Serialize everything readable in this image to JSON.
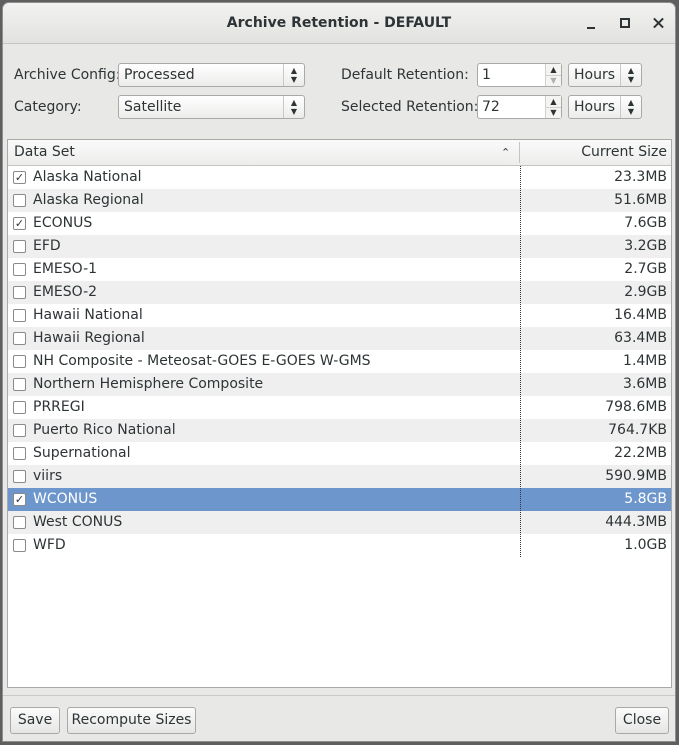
{
  "window": {
    "title": "Archive Retention - DEFAULT"
  },
  "form": {
    "archive_config_label": "Archive Config:",
    "archive_config_value": "Processed",
    "category_label": "Category:",
    "category_value": "Satellite",
    "default_retention_label": "Default Retention:",
    "default_retention_value": "1",
    "default_retention_unit": "Hours",
    "selected_retention_label": "Selected Retention:",
    "selected_retention_value": "72",
    "selected_retention_unit": "Hours"
  },
  "table": {
    "columns": [
      "Data Set",
      "Current Size"
    ],
    "rows": [
      {
        "name": "Alaska National",
        "size": "23.3MB",
        "checked": true,
        "selected": false
      },
      {
        "name": "Alaska Regional",
        "size": "51.6MB",
        "checked": false,
        "selected": false
      },
      {
        "name": "ECONUS",
        "size": "7.6GB",
        "checked": true,
        "selected": false
      },
      {
        "name": "EFD",
        "size": "3.2GB",
        "checked": false,
        "selected": false
      },
      {
        "name": "EMESO-1",
        "size": "2.7GB",
        "checked": false,
        "selected": false
      },
      {
        "name": "EMESO-2",
        "size": "2.9GB",
        "checked": false,
        "selected": false
      },
      {
        "name": "Hawaii National",
        "size": "16.4MB",
        "checked": false,
        "selected": false
      },
      {
        "name": "Hawaii Regional",
        "size": "63.4MB",
        "checked": false,
        "selected": false
      },
      {
        "name": "NH Composite - Meteosat-GOES E-GOES W-GMS",
        "size": "1.4MB",
        "checked": false,
        "selected": false
      },
      {
        "name": "Northern Hemisphere Composite",
        "size": "3.6MB",
        "checked": false,
        "selected": false
      },
      {
        "name": "PRREGI",
        "size": "798.6MB",
        "checked": false,
        "selected": false
      },
      {
        "name": "Puerto Rico National",
        "size": "764.7KB",
        "checked": false,
        "selected": false
      },
      {
        "name": "Supernational",
        "size": "22.2MB",
        "checked": false,
        "selected": false
      },
      {
        "name": "viirs",
        "size": "590.9MB",
        "checked": false,
        "selected": false
      },
      {
        "name": "WCONUS",
        "size": "5.8GB",
        "checked": true,
        "selected": true
      },
      {
        "name": "West CONUS",
        "size": "444.3MB",
        "checked": false,
        "selected": false
      },
      {
        "name": "WFD",
        "size": "1.0GB",
        "checked": false,
        "selected": false
      }
    ]
  },
  "buttons": {
    "save": "Save",
    "recompute": "Recompute Sizes",
    "close": "Close"
  },
  "colors": {
    "selection": "#6d97cc",
    "alt_row": "#efefef",
    "window_bg": "#e8e8e7"
  }
}
